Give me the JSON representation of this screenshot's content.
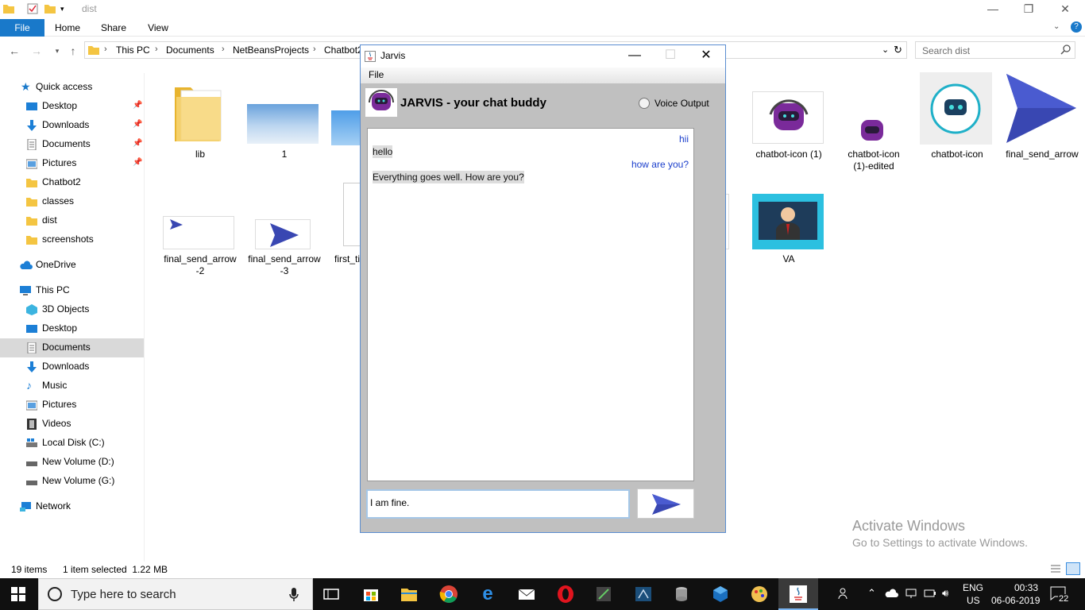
{
  "explorer": {
    "title": "dist",
    "ribbon_tabs": [
      "File",
      "Home",
      "Share",
      "View"
    ],
    "breadcrumbs": [
      "This PC",
      "Documents",
      "NetBeansProjects",
      "Chatbot2"
    ],
    "search_placeholder": "Search dist",
    "nav": {
      "quick_access": "Quick access",
      "quick_items": [
        "Desktop",
        "Downloads",
        "Documents",
        "Pictures",
        "Chatbot2",
        "classes",
        "dist",
        "screenshots"
      ],
      "onedrive": "OneDrive",
      "this_pc": "This PC",
      "pc_items": [
        "3D Objects",
        "Desktop",
        "Documents",
        "Downloads",
        "Music",
        "Pictures",
        "Videos",
        "Local Disk (C:)",
        "New Volume (D:)",
        "New Volume (G:)"
      ],
      "network": "Network"
    },
    "files": {
      "lib": "lib",
      "one": "1",
      "chatbot_icon_1": "chatbot-icon (1)",
      "chatbot_icon_1_edited_a": "chatbot-icon",
      "chatbot_icon_1_edited_b": "(1)-edited",
      "chatbot_icon": "chatbot-icon",
      "final_send_arrow": "final_send_arrow",
      "fsa2_a": "final_send_arrow",
      "fsa2_b": "-2",
      "fsa3_a": "final_send_arrow",
      "fsa3_b": "-3",
      "first_ti": "first_ti",
      "va": "VA"
    },
    "status": {
      "items": "19 items",
      "selected": "1 item selected  1.22 MB"
    }
  },
  "watermark": {
    "line1": "Activate Windows",
    "line2": "Go to Settings to activate Windows."
  },
  "jarvis": {
    "title": "Jarvis",
    "menu_file": "File",
    "header_title": "JARVIS - your chat buddy",
    "voice_output": "Voice Output",
    "messages": [
      {
        "from": "bot",
        "text": "hii"
      },
      {
        "from": "user",
        "text": "hello"
      },
      {
        "from": "bot",
        "text": "how are you?"
      },
      {
        "from": "user",
        "text": "Everything goes well. How are you?"
      }
    ],
    "input_value": "I am fine."
  },
  "taskbar": {
    "search_placeholder": "Type here to search",
    "lang_top": "ENG",
    "lang_bottom": "US",
    "time": "00:33",
    "date": "06-06-2019",
    "notifications": "22"
  },
  "colors": {
    "file_tab": "#1979ca",
    "bot_text": "#1a3ecc",
    "arrow_blue": "#3947b2",
    "chatbot_purple": "#7a2a9a"
  }
}
